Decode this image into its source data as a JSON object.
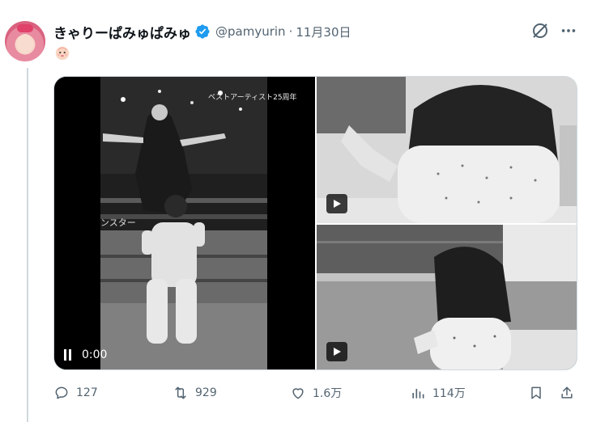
{
  "tweet": {
    "display_name": "きゃりーぱみゅぱみゅ",
    "handle": "@pamyurin",
    "separator": "·",
    "time": "11月30日",
    "verified_icon": "verified-badge-icon",
    "emoji_line": "👶"
  },
  "media": {
    "main_video": {
      "time_label": "0:00",
      "overlay_caption": "ベストアーティスト25周年",
      "overlay_side_text": "ンスター"
    },
    "top_right": {
      "icon": "play-icon"
    },
    "bottom_right": {
      "icon": "play-icon"
    }
  },
  "actions": {
    "reply_count": "127",
    "retweet_count": "929",
    "like_count": "1.6万",
    "views_count": "114万"
  },
  "colors": {
    "secondary_text": "#536471",
    "verified_blue": "#1d9bf0",
    "border": "#cfd9de"
  }
}
